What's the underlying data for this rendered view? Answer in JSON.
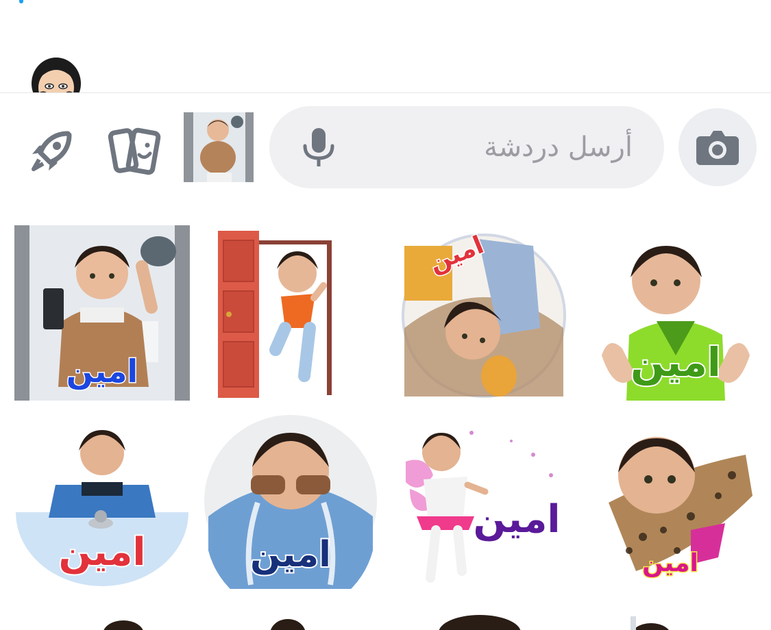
{
  "composer": {
    "placeholder": "أرسل دردشة"
  },
  "stickers": [
    {
      "label": "امين",
      "color": "#1b46e0"
    },
    {
      "label": "",
      "color": ""
    },
    {
      "label": "امين",
      "color": "#e2323b"
    },
    {
      "label": "امين",
      "color": "#3f9a17"
    },
    {
      "label": "امين",
      "color": "#e2323b"
    },
    {
      "label": "امين",
      "color": "#17307a"
    },
    {
      "label": "امين",
      "color": "#5a1a99"
    },
    {
      "label": "امين",
      "color": "#d9168a"
    }
  ],
  "icons": {
    "rocket": "rocket-icon",
    "cards": "sticker-cards-icon",
    "mic": "microphone-icon",
    "camera": "camera-icon"
  },
  "colors": {
    "icon_gray": "#6f7680",
    "input_bg": "#f0f0f2",
    "placeholder": "#9c9ca3",
    "accent": "#1ea1f2"
  }
}
